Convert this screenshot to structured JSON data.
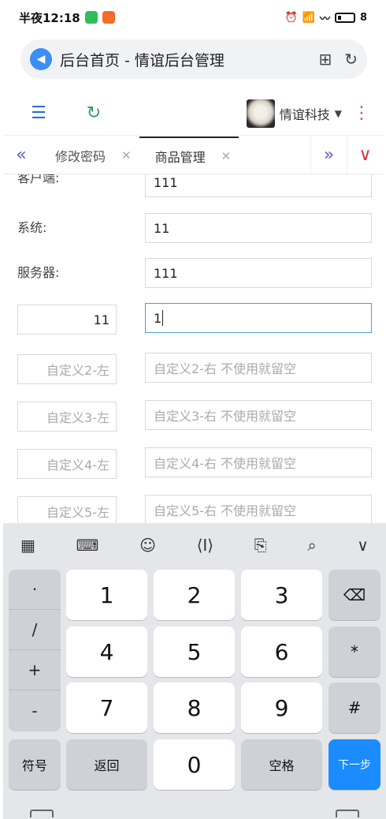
{
  "status_bar": {
    "time": "半夜12:18",
    "battery": "8"
  },
  "browser": {
    "title": "后台首页 - 情谊后台管理"
  },
  "header": {
    "user_name": "情谊科技"
  },
  "tabs": [
    {
      "label": "修改密码"
    },
    {
      "label": "商品管理"
    }
  ],
  "form": {
    "rows": [
      {
        "label": "客户端:",
        "value": "111"
      },
      {
        "label": "系统:",
        "value": "11"
      },
      {
        "label": "服务器:",
        "value": "111"
      }
    ],
    "custom_rows": [
      {
        "left_value": "11",
        "right_value": "1"
      },
      {
        "left_placeholder": "自定义2-左",
        "right_placeholder": "自定义2-右 不使用就留空"
      },
      {
        "left_placeholder": "自定义3-左",
        "right_placeholder": "自定义3-右 不使用就留空"
      },
      {
        "left_placeholder": "自定义4-左",
        "right_placeholder": "自定义4-右 不使用就留空"
      },
      {
        "left_placeholder": "自定义5-左",
        "right_placeholder": "自定义5-右 不使用就留空"
      }
    ]
  },
  "keyboard": {
    "symbols": [
      "·",
      "/",
      "+",
      "-"
    ],
    "digits": [
      "1",
      "2",
      "3",
      "4",
      "5",
      "6",
      "7",
      "8",
      "9",
      "0"
    ],
    "star": "*",
    "hash": "#",
    "sym_key": "符号",
    "back_key": "返回",
    "space_key": "空格",
    "next_key": "下一步"
  }
}
